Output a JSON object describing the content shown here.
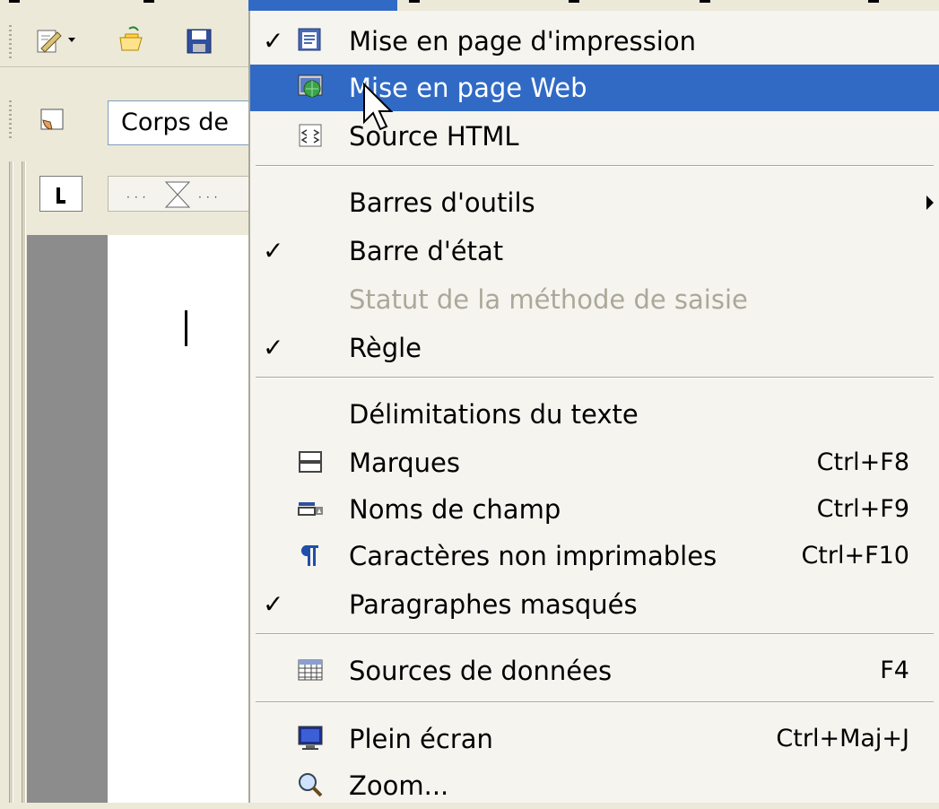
{
  "toolbar": {
    "paragraph_style": "Corps de"
  },
  "menu": {
    "items": [
      {
        "label": "Mise en page d'impression",
        "accel": "",
        "checked": true,
        "icon": "print-layout-icon"
      },
      {
        "label": "Mise en page Web",
        "accel": "",
        "checked": false,
        "icon": "web-layout-icon",
        "highlighted": true
      },
      {
        "label": "Source HTML",
        "accel": "",
        "checked": false,
        "icon": "html-source-icon"
      },
      {
        "label": "Barres d'outils",
        "accel": "",
        "submenu": true
      },
      {
        "label": "Barre d'état",
        "accel": "",
        "checked": true
      },
      {
        "label": "Statut de la méthode de saisie",
        "accel": "",
        "disabled": true
      },
      {
        "label": "Règle",
        "accel": "",
        "checked": true
      },
      {
        "label": "Délimitations du texte",
        "accel": ""
      },
      {
        "label": "Marques",
        "accel": "Ctrl+F8",
        "icon": "marks-icon"
      },
      {
        "label": "Noms de champ",
        "accel": "Ctrl+F9",
        "icon": "field-names-icon"
      },
      {
        "label": "Caractères non imprimables",
        "accel": "Ctrl+F10",
        "icon": "pilcrow-icon"
      },
      {
        "label": "Paragraphes masqués",
        "accel": "",
        "checked": true
      },
      {
        "label": "Sources de données",
        "accel": "F4",
        "icon": "data-sources-icon"
      },
      {
        "label": "Plein écran",
        "accel": "Ctrl+Maj+J",
        "icon": "monitor-icon"
      },
      {
        "label": "Zoom...",
        "accel": "",
        "icon": "zoom-icon"
      }
    ],
    "check_glyph": "✓"
  },
  "colors": {
    "highlight": "#316ac5",
    "menu_bg": "#f5f4ef",
    "disabled_text": "#aca899"
  }
}
